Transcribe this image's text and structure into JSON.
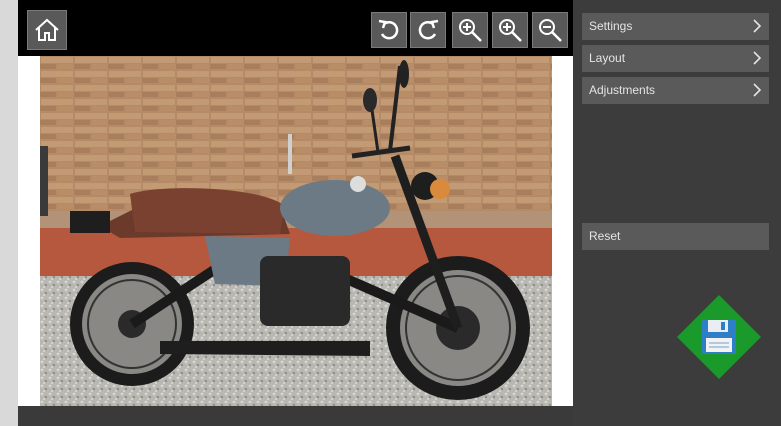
{
  "toolbar": {
    "home": {
      "icon": "home-icon"
    },
    "undo": {
      "icon": "undo-icon"
    },
    "redo": {
      "icon": "redo-icon"
    },
    "zoom_in": {
      "icon": "zoom-in-icon"
    },
    "zoom_fit": {
      "icon": "zoom-reset-icon"
    },
    "zoom_out": {
      "icon": "zoom-out-icon"
    }
  },
  "side_panel": {
    "items": [
      {
        "label": "Settings",
        "icon": "chevron-right-icon"
      },
      {
        "label": "Layout",
        "icon": "chevron-right-icon"
      },
      {
        "label": "Adjustments",
        "icon": "chevron-right-icon"
      }
    ],
    "reset_label": "Reset",
    "save": {
      "icon": "save-floppy-icon"
    }
  },
  "colors": {
    "background": "#3c3c3c",
    "toolbar": "#000000",
    "panel_button": "#5a5a5a",
    "save_accent": "#1a9a2a",
    "floppy": "#2f7fc8"
  }
}
